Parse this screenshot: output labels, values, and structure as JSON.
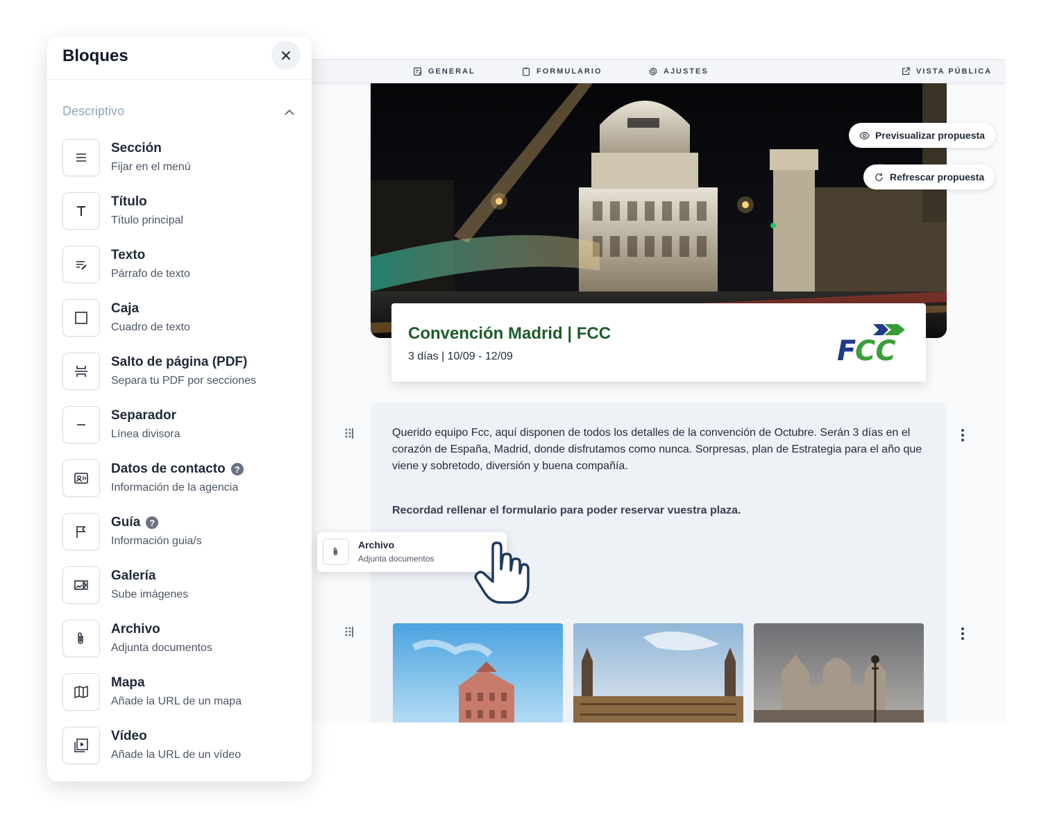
{
  "nav": {
    "general": "GENERAL",
    "formulario": "FORMULARIO",
    "ajustes": "AJUSTES",
    "vista_publica": "VISTA PÚBLICA"
  },
  "actions": {
    "preview": "Previsualizar propuesta",
    "refresh": "Refrescar propuesta"
  },
  "event": {
    "title": "Convención Madrid | FCC",
    "dates": "3 días | 10/09 - 12/09",
    "logo_text": "FCC"
  },
  "content": {
    "paragraph": "Querido equipo Fcc, aquí disponen de todos los detalles de la convención de Octubre. Serán 3 días en el corazón de España, Madrid, donde disfrutamos como nunca. Sorpresas, plan de Estrategia para el año que viene y sobretodo, diversión y buena compañía.",
    "reminder": "Recordad rellenar el formulario para poder reservar vuestra plaza."
  },
  "sidebar": {
    "title": "Bloques",
    "section": "Descriptivo",
    "items": [
      {
        "label": "Sección",
        "sub": "Fijar en el menú",
        "icon": "menu-lines-icon"
      },
      {
        "label": "Título",
        "sub": "Título principal",
        "icon": "title-t-icon"
      },
      {
        "label": "Texto",
        "sub": "Párrafo de texto",
        "icon": "text-edit-icon"
      },
      {
        "label": "Caja",
        "sub": "Cuadro de texto",
        "icon": "square-icon"
      },
      {
        "label": "Salto de página (PDF)",
        "sub": "Separa tu PDF por secciones",
        "icon": "page-break-icon"
      },
      {
        "label": "Separador",
        "sub": "Línea divisora",
        "icon": "minus-icon"
      },
      {
        "label": "Datos de contacto",
        "sub": "Información de la agencia",
        "icon": "contact-card-icon",
        "help": "?"
      },
      {
        "label": "Guía",
        "sub": "Información guia/s",
        "icon": "flag-icon",
        "help": "?"
      },
      {
        "label": "Galería",
        "sub": "Sube imágenes",
        "icon": "gallery-icon"
      },
      {
        "label": "Archivo",
        "sub": "Adjunta documentos",
        "icon": "paperclip-icon"
      },
      {
        "label": "Mapa",
        "sub": "Añade la URL de un mapa",
        "icon": "map-icon"
      },
      {
        "label": "Vídeo",
        "sub": "Añade la URL de un vídeo",
        "icon": "video-play-icon"
      }
    ]
  },
  "dragging": {
    "label": "Archivo",
    "sub": "Adjunta documentos"
  },
  "colors": {
    "brand_green": "#1d5d2b",
    "fcc_blue": "#1e3a8a",
    "fcc_green": "#3a9d3a"
  }
}
